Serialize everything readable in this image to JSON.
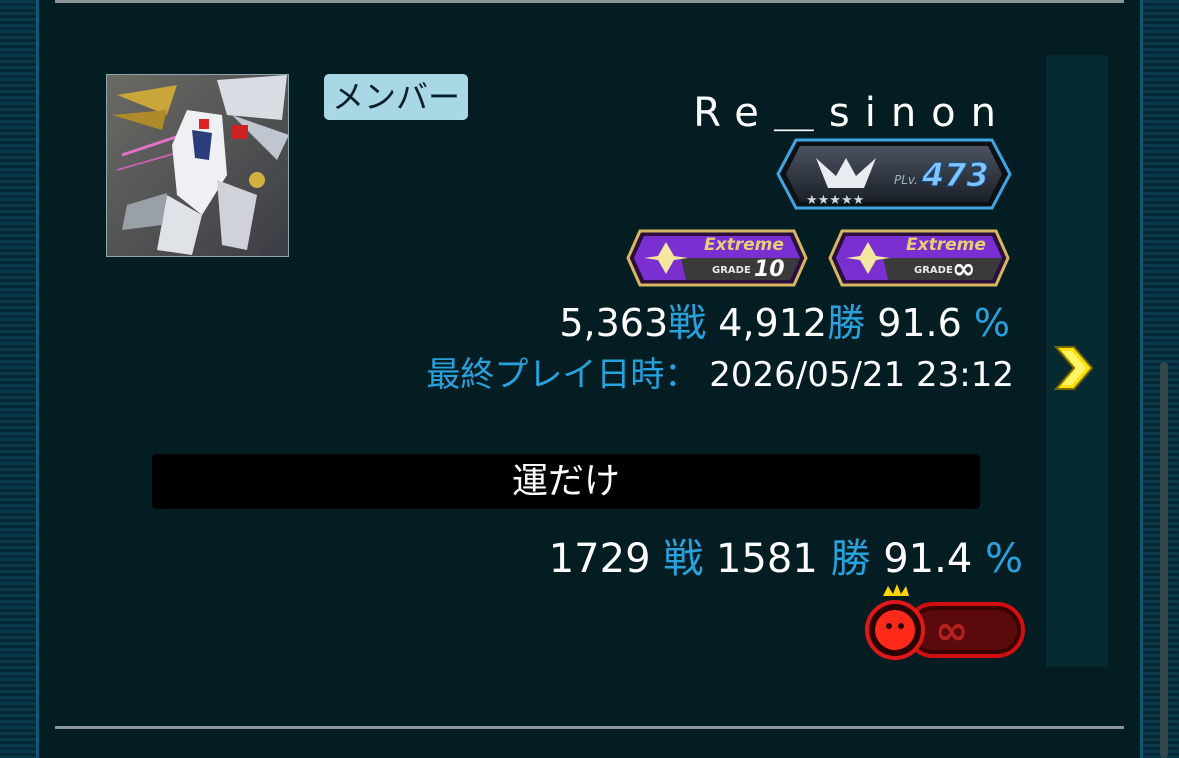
{
  "member_badge": "メンバー",
  "player_name": "Re＿sinon",
  "rank": {
    "prefix": "PLv.",
    "level": "473",
    "stars": "★★★★★"
  },
  "grades": [
    {
      "label": "Extreme",
      "grade_prefix": "GRADE",
      "grade_value": "10"
    },
    {
      "label": "Extreme",
      "grade_prefix": "GRADE",
      "grade_value": "∞"
    }
  ],
  "overall": {
    "battles": "5,363",
    "battles_unit": "戦",
    "wins": "4,912",
    "wins_unit": "勝",
    "rate": "91.6",
    "rate_unit": "%"
  },
  "last_play": {
    "label": "最終プレイ日時：",
    "value": "2026/05/21 23:12"
  },
  "team": {
    "name": "運だけ",
    "battles": "1729",
    "battles_unit": "戦",
    "wins": "1581",
    "wins_unit": "勝",
    "rate": "91.4",
    "rate_unit": "%",
    "team_grade_value": "∞"
  },
  "colors": {
    "accent": "#27a2dc",
    "chevron": "#ffe100",
    "badge_bg": "#a8d8e6"
  }
}
